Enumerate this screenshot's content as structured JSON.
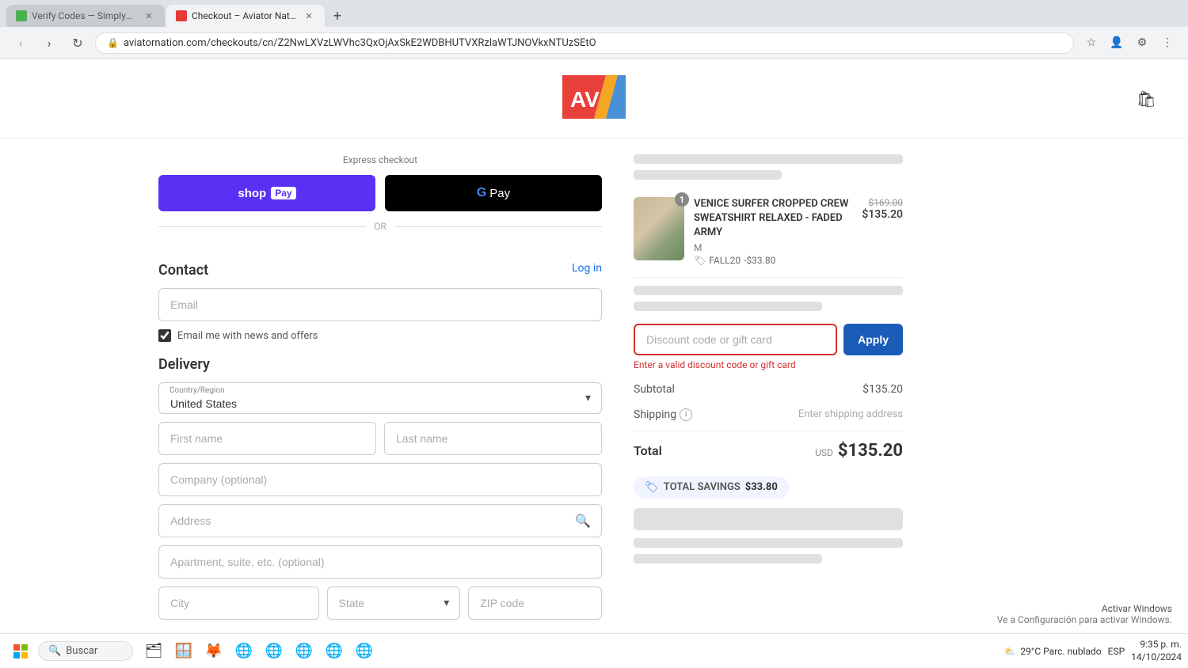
{
  "browser": {
    "tabs": [
      {
        "id": "tab1",
        "title": "Verify Codes — SimplyCodes",
        "active": false,
        "favicon_color": "#4caf50"
      },
      {
        "id": "tab2",
        "title": "Checkout – Aviator Nation",
        "active": true,
        "favicon_color": "#e53935"
      }
    ],
    "url": "aviatornation.com/checkouts/cn/Z2NwLXVzLWVhc3QxOjAxSkE2WDBHUTVXRzlaWTJNOVkxNTUzSEtO",
    "new_tab_label": "+"
  },
  "header": {
    "cart_label": "🛍",
    "logo_text": "AV"
  },
  "express_checkout": {
    "label": "Express checkout",
    "shop_pay_label": "shop Pay",
    "gpay_label": "Pay",
    "or_label": "OR"
  },
  "contact": {
    "section_title": "Contact",
    "login_text": "Log in",
    "email_placeholder": "Email",
    "newsletter_label": "Email me with news and offers",
    "newsletter_checked": true
  },
  "delivery": {
    "section_title": "Delivery",
    "country_label": "Country/Region",
    "country_value": "United States",
    "first_name_placeholder": "First name",
    "last_name_placeholder": "Last name",
    "company_placeholder": "Company (optional)",
    "address_placeholder": "Address",
    "apt_placeholder": "Apartment, suite, etc. (optional)",
    "city_placeholder": "City",
    "state_placeholder": "State",
    "zip_placeholder": "ZIP code"
  },
  "order_summary": {
    "product": {
      "name": "VENICE SURFER CROPPED CREW SWEATSHIRT RELAXED - FADED ARMY",
      "variant": "M",
      "discount_code": "FALL20",
      "discount_amount": "-$33.80",
      "original_price": "$169.00",
      "current_price": "$135.20",
      "quantity": 1
    },
    "discount": {
      "placeholder": "Discount code or gift card",
      "apply_label": "Apply",
      "error_text": "Enter a valid discount code or gift card"
    },
    "subtotal_label": "Subtotal",
    "subtotal_value": "$135.20",
    "shipping_label": "Shipping",
    "shipping_info": "ℹ",
    "shipping_note": "Enter shipping address",
    "total_label": "Total",
    "total_currency": "USD",
    "total_amount": "$135.20",
    "savings_label": "TOTAL SAVINGS",
    "savings_amount": "$33.80"
  },
  "taskbar": {
    "search_label": "Buscar",
    "time": "9:35 p. m.",
    "date": "14/10/2024",
    "language": "ESP",
    "weather": "29°C Parc. nublado",
    "activate_line1": "Activar Windows",
    "activate_line2": "Ve a Configuración para activar Windows."
  }
}
